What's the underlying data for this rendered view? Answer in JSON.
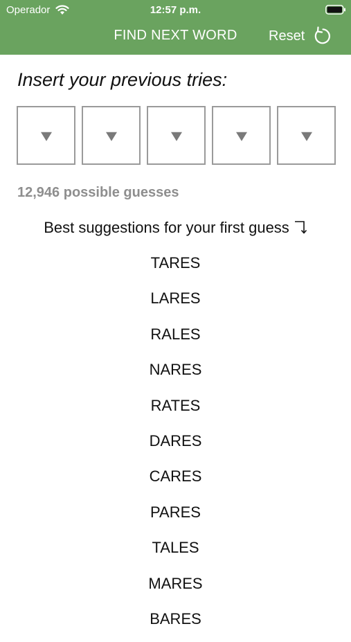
{
  "status_bar": {
    "carrier": "Operador",
    "time": "12:57 p.m.",
    "wifi_icon": "wifi-icon",
    "battery_icon": "battery-icon"
  },
  "nav": {
    "title": "FIND NEXT WORD",
    "reset_label": "Reset",
    "reset_icon": "reset-arrow-icon",
    "background_color": "#6aa35f"
  },
  "prompt": "Insert your previous tries:",
  "slots": [
    {
      "icon": "dropdown-caret-icon"
    },
    {
      "icon": "dropdown-caret-icon"
    },
    {
      "icon": "dropdown-caret-icon"
    },
    {
      "icon": "dropdown-caret-icon"
    },
    {
      "icon": "dropdown-caret-icon"
    }
  ],
  "possible_guesses": "12,946 possible guesses",
  "suggestions_heading": "Best suggestions for your first guess",
  "suggestions": [
    "TARES",
    "LARES",
    "RALES",
    "NARES",
    "RATES",
    "DARES",
    "CARES",
    "PARES",
    "TALES",
    "MARES",
    "BARES"
  ]
}
